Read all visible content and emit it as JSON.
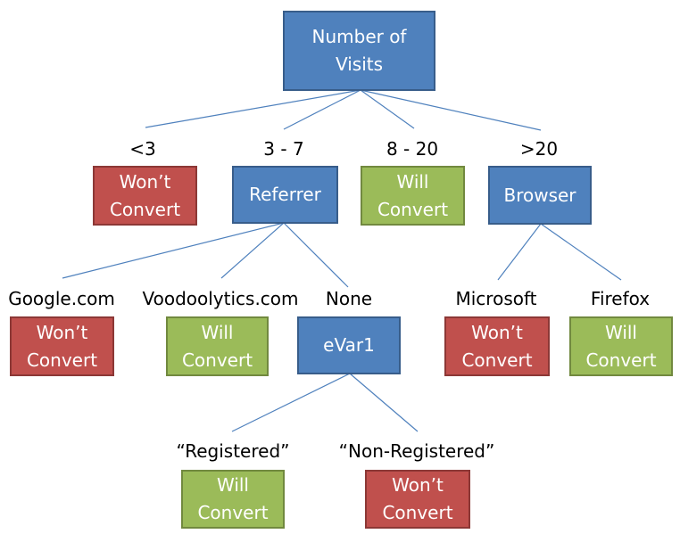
{
  "diagram": {
    "type": "decision-tree",
    "colors": {
      "decision_fill": "#4f81bd",
      "decision_border": "#385d8a",
      "wont_convert_fill": "#c0504d",
      "wont_convert_border": "#8c3836",
      "will_convert_fill": "#9bbb59",
      "will_convert_border": "#71893f",
      "edge": "#4f81bd"
    },
    "nodes": {
      "root": {
        "label": "Number of\nVisits",
        "kind": "decision"
      },
      "lt3": {
        "label": "Won’t\nConvert",
        "kind": "wont"
      },
      "referrer": {
        "label": "Referrer",
        "kind": "decision"
      },
      "v8to20": {
        "label": "Will\nConvert",
        "kind": "will"
      },
      "browser": {
        "label": "Browser",
        "kind": "decision"
      },
      "google": {
        "label": "Won’t\nConvert",
        "kind": "wont"
      },
      "voodoo": {
        "label": "Will\nConvert",
        "kind": "will"
      },
      "evar1": {
        "label": "eVar1",
        "kind": "decision"
      },
      "microsoft": {
        "label": "Won’t\nConvert",
        "kind": "wont"
      },
      "firefox": {
        "label": "Will\nConvert",
        "kind": "will"
      },
      "registered": {
        "label": "Will\nConvert",
        "kind": "will"
      },
      "nonregistered": {
        "label": "Won’t\nConvert",
        "kind": "wont"
      }
    },
    "edges": [
      {
        "from": "root",
        "to": "lt3",
        "label": "<3"
      },
      {
        "from": "root",
        "to": "referrer",
        "label": "3 - 7"
      },
      {
        "from": "root",
        "to": "v8to20",
        "label": "8 - 20"
      },
      {
        "from": "root",
        "to": "browser",
        "label": ">20"
      },
      {
        "from": "referrer",
        "to": "google",
        "label": "Google.com"
      },
      {
        "from": "referrer",
        "to": "voodoo",
        "label": "Voodoolytics.com"
      },
      {
        "from": "referrer",
        "to": "evar1",
        "label": "None"
      },
      {
        "from": "browser",
        "to": "microsoft",
        "label": "Microsoft"
      },
      {
        "from": "browser",
        "to": "firefox",
        "label": "Firefox"
      },
      {
        "from": "evar1",
        "to": "registered",
        "label": "“Registered”"
      },
      {
        "from": "evar1",
        "to": "nonregistered",
        "label": "“Non-Registered”"
      }
    ]
  }
}
